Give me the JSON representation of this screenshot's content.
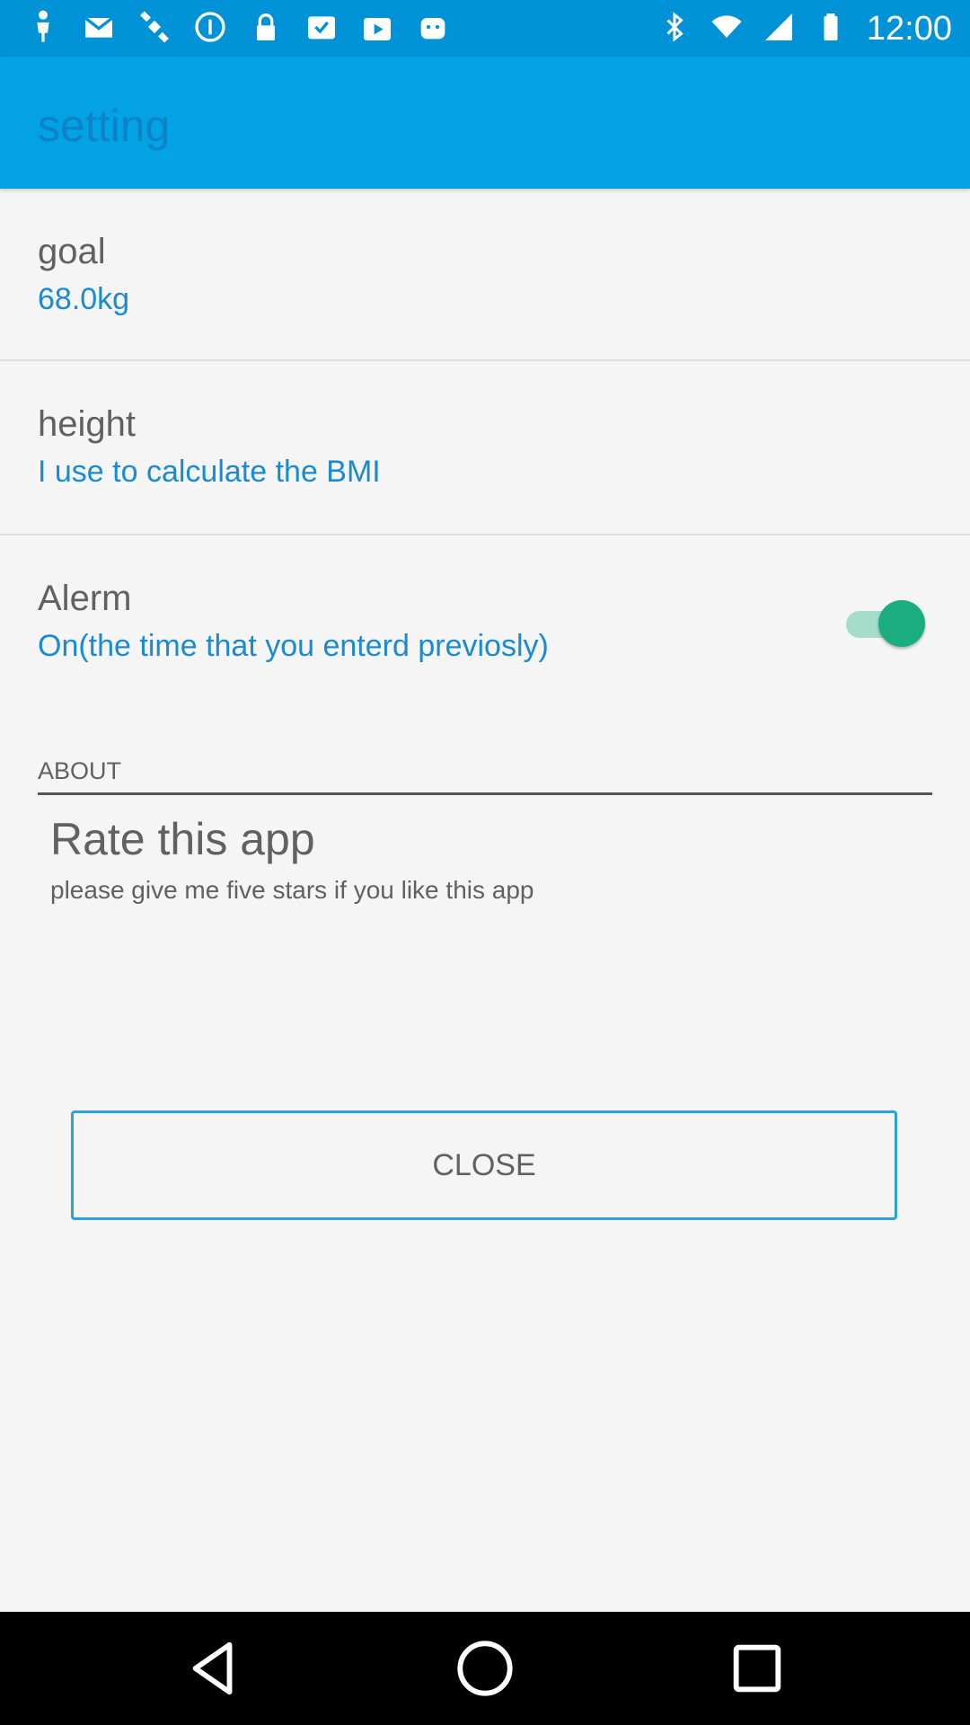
{
  "status_bar": {
    "time": "12:00",
    "left_icons": [
      "person-icon",
      "mail-icon",
      "satellite-fake-gps-icon",
      "info-icon",
      "lock-icon",
      "checklist-icon",
      "play-store-icon",
      "android-icon"
    ],
    "right_icons": [
      "bluetooth-icon",
      "wifi-icon",
      "signal-icon",
      "battery-icon"
    ],
    "colors": {
      "background": "#0092d6"
    }
  },
  "app_bar": {
    "title": "setting",
    "color": "#03a2e5"
  },
  "preferences": [
    {
      "title": "goal",
      "summary": "68.0kg"
    },
    {
      "title": "height",
      "summary": "I use to calculate the BMI"
    },
    {
      "title": "Alerm",
      "summary": "On(the time that you enterd previosly)",
      "toggle_on": true
    }
  ],
  "about": {
    "header": "ABOUT",
    "rate_title": "Rate this app",
    "rate_summary": "please give me five stars if you like this app"
  },
  "close_button": {
    "label": "CLOSE"
  },
  "nav_bar": {
    "buttons": [
      "back-icon",
      "home-icon",
      "recents-icon"
    ]
  },
  "theme": {
    "accent": "#1a8ad2",
    "toggle_on": "#1aae7f"
  }
}
